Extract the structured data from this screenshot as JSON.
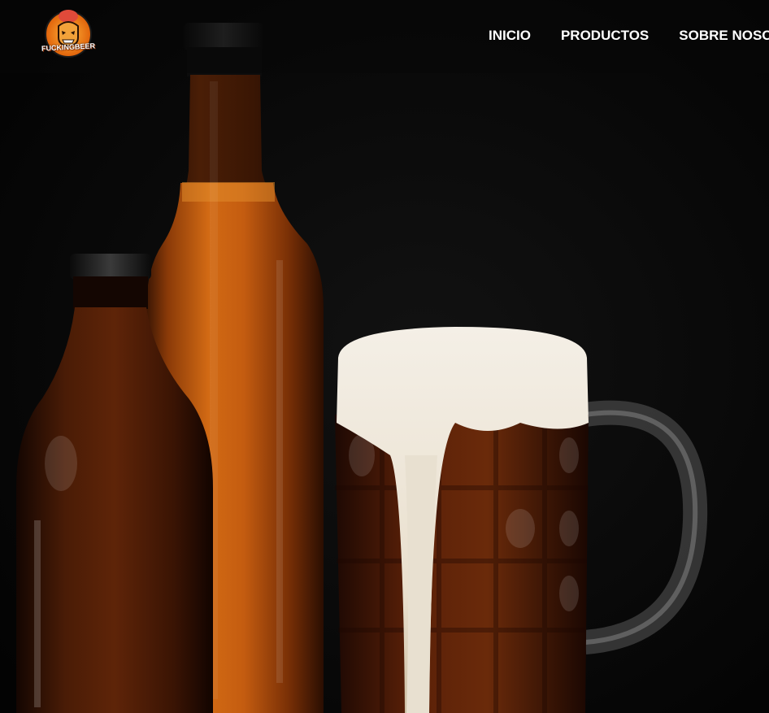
{
  "brand": {
    "logo_text": "FUCKINGBEER",
    "logo_icon": "skull-mascot-icon",
    "accent_color": "#f08a1c"
  },
  "nav": {
    "items": [
      {
        "label": "INICIO"
      },
      {
        "label": "PRODUCTOS"
      },
      {
        "label": "SOBRE NOSOTROS"
      }
    ]
  },
  "hero": {
    "image": "beer-bottles-and-foaming-mug-photo",
    "background_color": "#050505"
  }
}
